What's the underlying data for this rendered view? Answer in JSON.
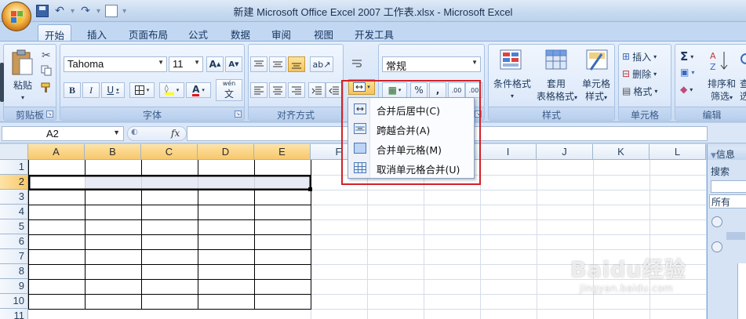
{
  "window": {
    "title": "新建 Microsoft Office Excel 2007 工作表.xlsx - Microsoft Excel"
  },
  "tabs": [
    "开始",
    "插入",
    "页面布局",
    "公式",
    "数据",
    "审阅",
    "视图",
    "开发工具"
  ],
  "ribbon": {
    "clipboard": {
      "paste": "粘贴",
      "label": "剪贴板"
    },
    "font": {
      "name": "Tahoma",
      "size": "11",
      "bold": "B",
      "italic": "I",
      "underline": "U",
      "grow": "A",
      "shrink": "A",
      "color_glyph": "A",
      "phonetic": "wén",
      "phonetic_char": "文",
      "label": "字体"
    },
    "alignment": {
      "label": "对齐方式"
    },
    "number": {
      "format": "常规",
      "percent": "%",
      "comma": ",",
      "inc_decimal": ".00",
      "dec_decimal": ".00",
      "label": "数字"
    },
    "styles": {
      "conditional": "条件格式",
      "table_line1": "套用",
      "table_line2": "表格格式",
      "cell_line1": "单元格",
      "cell_line2": "样式",
      "label": "样式"
    },
    "cells": {
      "insert": "插入",
      "delete": "删除",
      "format": "格式",
      "label": "单元格"
    },
    "editing": {
      "sigma": "Σ",
      "sort_line1": "排序和",
      "sort_line2": "筛选",
      "find_fragment": "查",
      "find_fragment2": "选",
      "label": "编辑"
    }
  },
  "formula_bar": {
    "name_box": "A2",
    "fx": "fx",
    "value": ""
  },
  "grid": {
    "columns": [
      "A",
      "B",
      "C",
      "D",
      "E",
      "F",
      "G",
      "H",
      "I",
      "J",
      "K",
      "L"
    ],
    "rows": [
      "1",
      "2",
      "3",
      "4",
      "5",
      "6",
      "7",
      "8",
      "9",
      "10",
      "11"
    ],
    "selected_row": "2",
    "selected_columns": [
      "A",
      "B",
      "C",
      "D",
      "E"
    ]
  },
  "merge_menu": {
    "items": [
      {
        "label": "合并后居中(C)"
      },
      {
        "label": "跨越合并(A)"
      },
      {
        "label": "合并单元格(M)"
      },
      {
        "label": "取消单元格合并(U)"
      }
    ]
  },
  "task_pane": {
    "title": "信息",
    "search": "搜索",
    "scope": "所有"
  },
  "watermark": {
    "line1": "Baidu经验",
    "line2": "jingyan.baidu.com"
  },
  "colors": {
    "highlight_border": "#d32128",
    "selection_header": "#f8c86d",
    "ribbon_bg": "#dfeaf7"
  }
}
